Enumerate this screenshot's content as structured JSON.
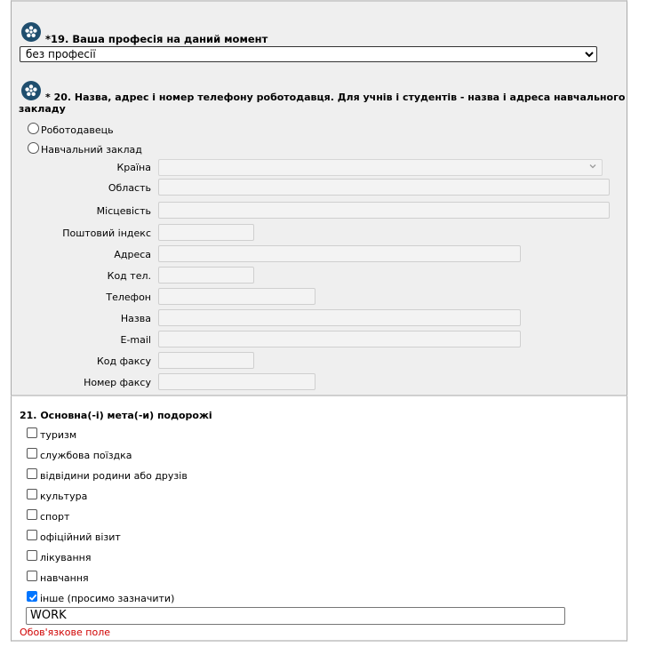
{
  "q19": {
    "icon": "asterisk-badge-icon",
    "title": "*19. Ваша професія на даний момент",
    "selected": "без професії"
  },
  "q20": {
    "icon": "asterisk-badge-icon",
    "title_line1": "* 20. Назва, адрес і номер телефону роботодавця. Для учнів і студентів - назва і адреса навчального",
    "title_line2": "закладу",
    "options": [
      "Роботодавець",
      "Навчальний заклад"
    ],
    "fields": {
      "country": "Країна",
      "region": "Область",
      "locality": "Місцевість",
      "postcode": "Поштовий індекс",
      "address": "Адреса",
      "phone_code": "Код тел.",
      "phone": "Телефон",
      "name": "Назва",
      "email": "E-mail",
      "fax_code": "Код факсу",
      "fax": "Номер факсу"
    }
  },
  "q21": {
    "title": "21. Основна(-і) мета(-и) подорожі",
    "options": [
      {
        "label": "туризм",
        "checked": false
      },
      {
        "label": "службова поїздка",
        "checked": false
      },
      {
        "label": "відвідини родини або друзів",
        "checked": false
      },
      {
        "label": "культура",
        "checked": false
      },
      {
        "label": "спорт",
        "checked": false
      },
      {
        "label": "офіційний візит",
        "checked": false
      },
      {
        "label": "лікування",
        "checked": false
      },
      {
        "label": "навчання",
        "checked": false
      },
      {
        "label": "інше (просимо зазначити)",
        "checked": true
      }
    ],
    "other_value": "WORK",
    "error": "Обов'язкове поле"
  },
  "colors": {
    "panel_bg": "#efefef",
    "icon_bg": "#1f4e6e",
    "checkbox_checked": "#0075ff",
    "error": "#d00000"
  }
}
